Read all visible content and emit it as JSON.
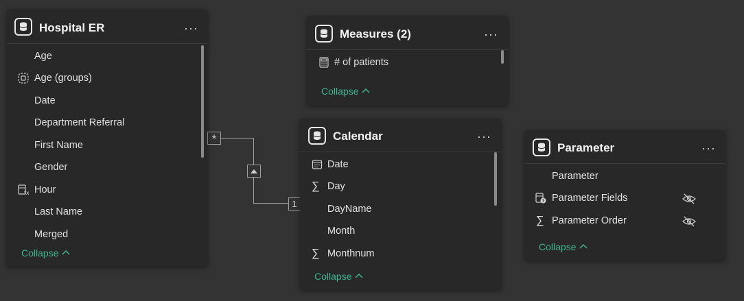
{
  "tables": {
    "hospital": {
      "title": "Hospital ER",
      "more": "···",
      "fields": [
        "Age",
        "Age (groups)",
        "Date",
        "Department Referral",
        "First Name",
        "Gender",
        "Hour",
        "Last Name",
        "Merged"
      ],
      "collapse": "Collapse"
    },
    "measures": {
      "title": "Measures (2)",
      "more": "···",
      "fields": [
        "# of patients"
      ],
      "collapse": "Collapse"
    },
    "calendar": {
      "title": "Calendar",
      "more": "···",
      "fields": [
        "Date",
        "Day",
        "DayName",
        "Month",
        "Monthnum"
      ],
      "collapse": "Collapse"
    },
    "parameter": {
      "title": "Parameter",
      "more": "···",
      "fields": [
        "Parameter",
        "Parameter Fields",
        "Parameter Order"
      ],
      "collapse": "Collapse"
    }
  },
  "relationship": {
    "many_label": "*",
    "one_label": "1"
  },
  "colors": {
    "canvas": "#333333",
    "card": "#282828",
    "accent": "#3fb491"
  }
}
